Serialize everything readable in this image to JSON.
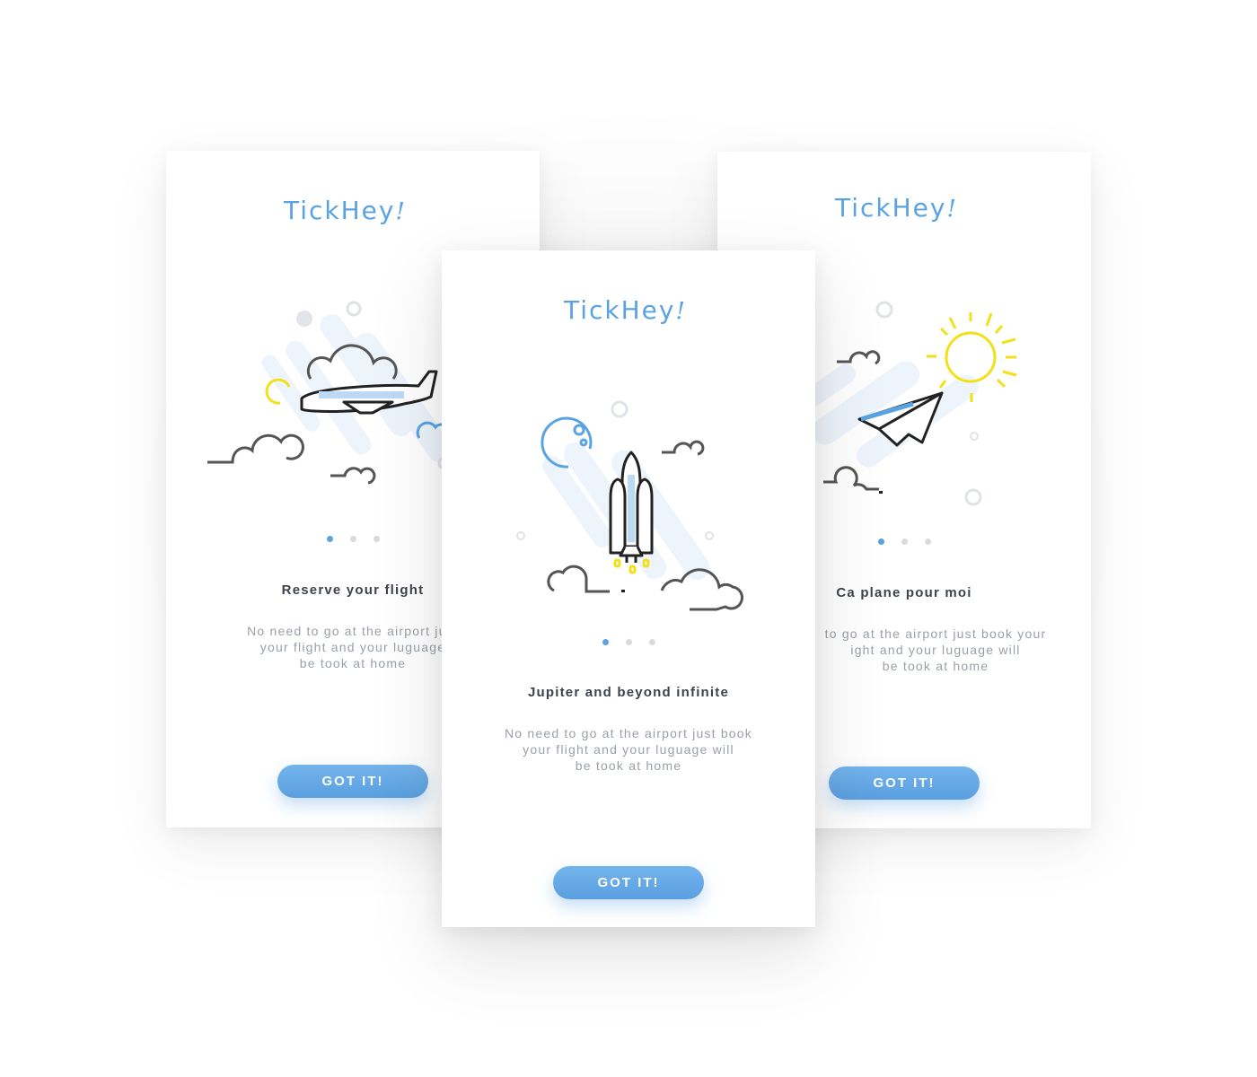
{
  "app": {
    "brand_name": "TickHey",
    "brand_mark": "!",
    "accent_color": "#5aa3e3"
  },
  "cards": [
    {
      "position": "left",
      "title": "Reserve your flight",
      "description_lines": [
        "No need to go at the airport just",
        "your flight and your luguage",
        "be took at home"
      ],
      "button_label": "GOT IT!",
      "illustration": "airplane-icon",
      "pagination": {
        "total": 3,
        "active": 1
      }
    },
    {
      "position": "center",
      "title": "Jupiter and beyond infinite",
      "description_lines": [
        "No need to go at the airport just book",
        "your flight and your luguage will",
        "be took at home"
      ],
      "button_label": "GOT IT!",
      "illustration": "rocket-icon",
      "pagination": {
        "total": 3,
        "active": 1
      }
    },
    {
      "position": "right",
      "title": "Ca plane pour moi",
      "description_lines": [
        "to go at the airport just book your",
        "ight and your luguage will",
        "be took at home"
      ],
      "button_label": "GOT IT!",
      "illustration": "paper-plane-icon",
      "pagination": {
        "total": 3,
        "active": 1
      }
    }
  ]
}
